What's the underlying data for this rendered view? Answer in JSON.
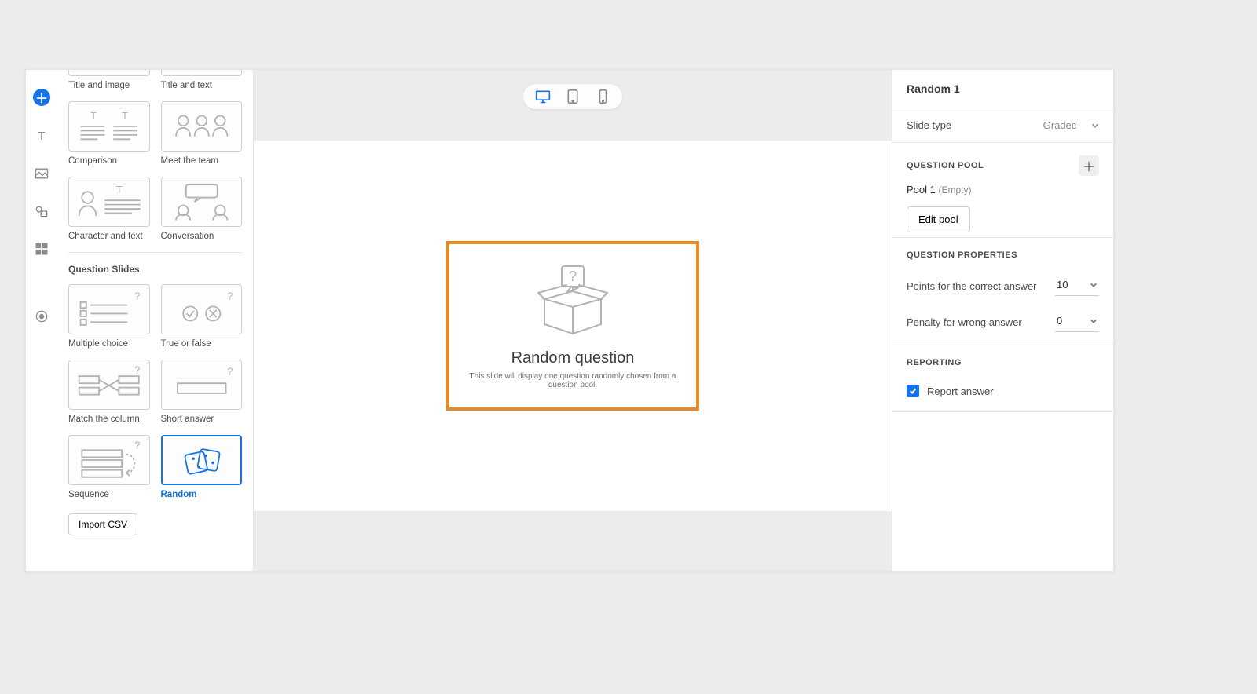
{
  "picker": {
    "content_slides": [
      {
        "id": "title-and-image",
        "label": "Title and image",
        "clipped": true
      },
      {
        "id": "title-and-text",
        "label": "Title and text",
        "clipped": true
      },
      {
        "id": "comparison",
        "label": "Comparison"
      },
      {
        "id": "meet-the-team",
        "label": "Meet the team"
      },
      {
        "id": "character-and-text",
        "label": "Character and text"
      },
      {
        "id": "conversation",
        "label": "Conversation"
      }
    ],
    "question_section_label": "Question Slides",
    "question_slides": [
      {
        "id": "multiple-choice",
        "label": "Multiple choice"
      },
      {
        "id": "true-or-false",
        "label": "True or false"
      },
      {
        "id": "match-the-column",
        "label": "Match the column"
      },
      {
        "id": "short-answer",
        "label": "Short answer"
      },
      {
        "id": "sequence",
        "label": "Sequence"
      },
      {
        "id": "random",
        "label": "Random",
        "selected": true
      }
    ],
    "import_button": "Import CSV"
  },
  "canvas": {
    "title": "Random question",
    "subtitle": "This slide will display one question randomly chosen from a question pool."
  },
  "props": {
    "title": "Random 1",
    "slide_type_label": "Slide type",
    "slide_type_value": "Graded",
    "question_pool_label": "QUESTION POOL",
    "pool_name": "Pool 1",
    "pool_status": "(Empty)",
    "edit_pool_btn": "Edit pool",
    "question_properties_label": "QUESTION PROPERTIES",
    "points_label": "Points for the correct answer",
    "points_value": "10",
    "penalty_label": "Penalty for wrong answer",
    "penalty_value": "0",
    "reporting_label": "REPORTING",
    "report_answer_label": "Report answer",
    "report_answer_checked": true
  }
}
